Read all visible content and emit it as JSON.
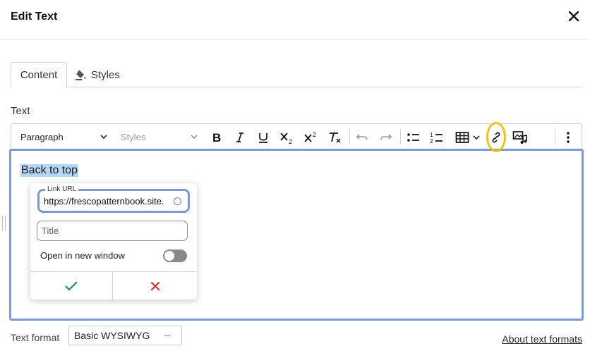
{
  "dialog": {
    "title": "Edit Text",
    "close_icon": "close-icon"
  },
  "tabs": [
    {
      "label": "Content",
      "active": true
    },
    {
      "label": "Styles",
      "icon": "paint-bucket-icon",
      "active": false
    }
  ],
  "field": {
    "label": "Text"
  },
  "toolbar": {
    "paragraph_select": "Paragraph",
    "styles_select": "Styles",
    "buttons": [
      "bold",
      "italic",
      "underline",
      "subscript",
      "superscript",
      "remove-format",
      "undo",
      "redo",
      "bulleted-list",
      "numbered-list",
      "insert-table",
      "link",
      "insert-media",
      "more-options"
    ]
  },
  "editor": {
    "content": "Back to top"
  },
  "link_popup": {
    "url_label": "Link URL",
    "url_value": "https://frescopatternbook.site.",
    "title_placeholder": "Title",
    "new_window_label": "Open in new window",
    "new_window_enabled": false,
    "confirm_color": "#1a8a5a",
    "cancel_color": "#d42b2b"
  },
  "footer": {
    "text_format_label": "Text format",
    "text_format_value": "Basic WYSIWYG",
    "about_link": "About text formats"
  },
  "colors": {
    "accent": "#7b9bd6",
    "highlight": "#f4c20d",
    "selection": "#b4d7f5"
  }
}
